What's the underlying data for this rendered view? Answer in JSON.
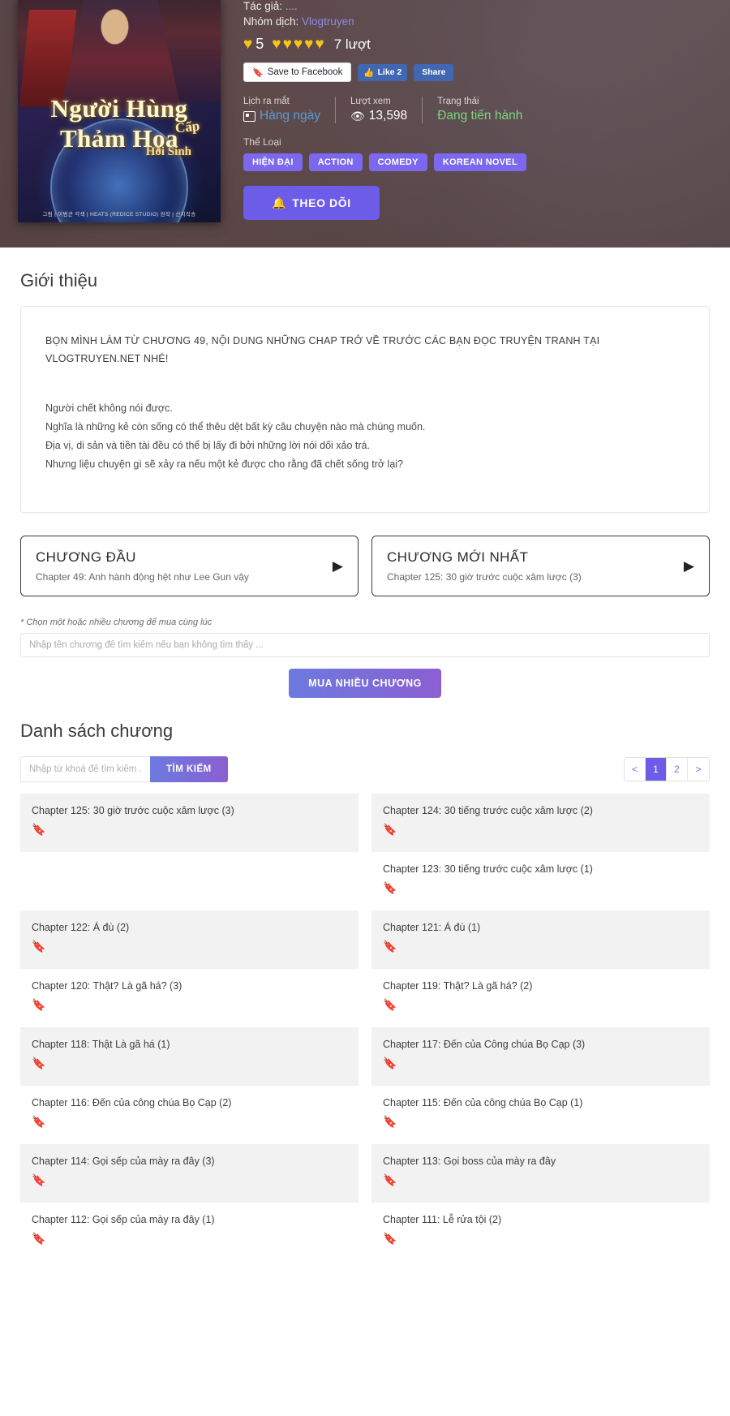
{
  "hero": {
    "cover": {
      "title_line1": "Người Hùng",
      "title_line2": "Thảm Họa",
      "title_cap": "Cấp",
      "title_sub": "Hồi Sinh",
      "credits": "그림 | 이범군      각색 | HEATS (REDICE STUDIO)      원작 | 산지직송"
    },
    "author_label": "Tác giả:",
    "author_value": "....",
    "team_label": "Nhóm dịch:",
    "team_value": "Vlogtruyen",
    "rating_value": "5",
    "rating_count": "7 lượt",
    "heart_icon": "♥",
    "hearts_filled": 5,
    "social": {
      "save_label": "Save to Facebook",
      "like_label": "Like 2",
      "share_label": "Share"
    },
    "stats": [
      {
        "label": "Lịch ra mắt",
        "value": "Hàng ngày",
        "icon": "calendar-icon"
      },
      {
        "label": "Lượt xem",
        "value": "13,598",
        "icon": "eye-icon"
      },
      {
        "label": "Trạng thái",
        "value": "Đang tiến hành",
        "icon": ""
      }
    ],
    "genre_label": "Thể Loại",
    "genres": [
      "HIỆN ĐẠI",
      "ACTION",
      "COMEDY",
      "KOREAN NOVEL"
    ],
    "follow_label": "THEO DÕI",
    "follow_icon": "bell-icon"
  },
  "intro": {
    "heading": "Giới thiệu",
    "notice": "BỌN MÌNH LÀM TỪ CHƯƠNG 49, NỘI DUNG NHỮNG CHAP TRỞ VỀ TRƯỚC CÁC BẠN ĐỌC TRUYỆN TRANH TẠI VLOGTRUYEN.NET NHÉ!",
    "paragraphs": [
      "Người chết không nói được.",
      "Nghĩa là những kẻ còn sống có thể thêu dệt bất kỳ câu chuyện nào mà chúng muốn.",
      "Địa vị, di sản và tiền tài đều có thể bị lấy đi bởi những lời nói dối xảo trá.",
      "Nhưng liệu chuyện gì sẽ xảy ra nếu một kẻ được cho rằng đã chết sống trở lại?"
    ]
  },
  "chapter_nav": {
    "first": {
      "title": "CHƯƠNG ĐẦU",
      "subtitle": "Chapter 49: Anh hành động hệt như Lee Gun vậy",
      "arrow": "▶"
    },
    "latest": {
      "title": "CHƯƠNG MỚI NHẤT",
      "subtitle": "Chapter 125: 30 giờ trước cuộc xâm lược (3)",
      "arrow": "▶"
    }
  },
  "buy": {
    "hint": "* Chọn một hoặc nhiều chương để mua cùng lúc",
    "input_placeholder": "Nhập tên chương để tìm kiếm nếu bạn không tìm thấy ...",
    "input_value": "",
    "button_label": "MUA NHIỀU CHƯƠNG"
  },
  "chapter_list": {
    "heading": "Danh sách chương",
    "search_placeholder": "Nhập từ khoá để tìm kiếm ...",
    "search_value": "",
    "search_button": "TÌM KIẾM",
    "pager": {
      "prev": "<",
      "pages": [
        "1",
        "2"
      ],
      "active": "1",
      "next": ">"
    },
    "bookmark_icon": "🔖",
    "left_column": [
      {
        "label": "Chapter 125: 30 giờ trước cuộc xâm lược (3)",
        "shaded": true
      },
      {
        "label": "",
        "shaded": false,
        "blank": true
      },
      {
        "label": "Chapter 122: Á đù (2)",
        "shaded": true
      },
      {
        "label": "Chapter 120: Thật? Là gã há? (3)",
        "shaded": false
      },
      {
        "label": "Chapter 118: Thật Là gã há (1)",
        "shaded": true
      },
      {
        "label": "Chapter 116: Đến của công chúa Bọ Cạp (2)",
        "shaded": false
      },
      {
        "label": "Chapter 114: Gọi sếp của mày ra đây (3)",
        "shaded": true
      },
      {
        "label": "Chapter 112: Gọi sếp của mày ra đây (1)",
        "shaded": false
      }
    ],
    "right_column": [
      {
        "label": "Chapter 124: 30 tiếng trước cuộc xâm lược (2)",
        "shaded": true
      },
      {
        "label": "Chapter 123: 30 tiếng trước cuộc xâm lược (1)",
        "shaded": false
      },
      {
        "label": "Chapter 121: Á đù (1)",
        "shaded": true
      },
      {
        "label": "Chapter 119: Thật? Là gã há? (2)",
        "shaded": false
      },
      {
        "label": "Chapter 117: Đến của Công chúa Bọ Cạp (3)",
        "shaded": true
      },
      {
        "label": "Chapter 115: Đến của công chúa Bọ Cạp (1)",
        "shaded": false
      },
      {
        "label": "Chapter 113: Gọi boss của mày ra đây",
        "shaded": true
      },
      {
        "label": "Chapter 111: Lễ rửa tội (2)",
        "shaded": false
      }
    ]
  }
}
